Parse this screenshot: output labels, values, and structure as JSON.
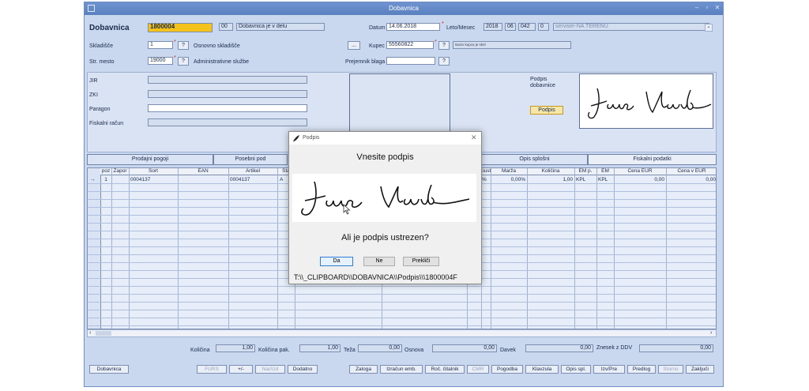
{
  "window": {
    "title": "Dobavnica"
  },
  "header": {
    "doc_label": "Dobavnica",
    "doc_number": "1800004",
    "status_code": "00",
    "status_text": "Dobavnica je v delu",
    "datum_label": "Datum",
    "datum_value": "14.06.2018",
    "leto_label": "Leto/Mesec",
    "leto_value": "2018",
    "mesec_value": "06",
    "num1": "042",
    "num2": "0",
    "servis_value": "serviser-NA TERENU",
    "skladisce_label": "Skladišče",
    "skladisce_value": "1",
    "skladisce_name": "Osnovno skladišče",
    "kupec_label": "Kupec",
    "kupec_value": "55560822",
    "kupec_name": "Naziv kupca je skrit",
    "strmesto_label": "Str. mesto",
    "strmesto_value": "19000",
    "strmesto_name": "Administrativne službe",
    "prejemnik_label": "Prejemnik blaga",
    "q": "?",
    "dots": "..."
  },
  "fiscal": {
    "jir": "JIR",
    "zki": "ZKI",
    "paragon": "Paragon",
    "racun": "Fiskalni račun"
  },
  "signature_panel": {
    "label": "Podpis dobavnice",
    "button": "Podpis"
  },
  "tabs": [
    "Prodajni pogoji",
    "Posebni pod",
    "Opis splošni",
    "Fiskalni podatki"
  ],
  "grid": {
    "headers_left": [
      "poz",
      "Zapor",
      "Sort",
      "EAN",
      "Artikel",
      "Sta"
    ],
    "headers_right": [
      "pust",
      "Marža",
      "Količina",
      "EM p.",
      "EM",
      "Cena EUR",
      "Cena v EUR"
    ],
    "row": {
      "arrow": "→",
      "poz": "1",
      "sort": "0004137",
      "artikel": "0004137",
      "sta": "A",
      "pust": "%",
      "marza": "0,00%",
      "kolicina": "1,00",
      "emp": "KPL",
      "em": "KPL",
      "cena": "0,00",
      "cenav": "0,00"
    }
  },
  "totals": {
    "kolicina_label": "Količina",
    "kolicina": "1,00",
    "kolpak_label": "Količina pak.",
    "kolpak": "1,00",
    "teza_label": "Teža",
    "teza": "0,00",
    "osnova_label": "Osnova",
    "osnova": "0,00",
    "davek_label": "Davek",
    "davek": "0,00",
    "znesek_label": "Znesek z DDV",
    "znesek": "0,00"
  },
  "bottom_buttons": {
    "dobavnica": "Dobavnica",
    "furs": "FURS",
    "plusminus": "+/-",
    "narizd": "Nar/izd",
    "dodatno": "Dodatno",
    "zaloga": "Zaloga",
    "izracun": "Izračun emb.",
    "roc": "Roč. čitalnik",
    "cmr": "CMR",
    "pogodba": "Pogodba",
    "klavzula": "Klavzula",
    "opisspl": "Opis spl.",
    "izvpre": "Izv/Pre",
    "predlog": "Predlog",
    "storno": "Storno",
    "zakljuci": "Zaključi"
  },
  "dialog": {
    "title": "Podpis",
    "prompt": "Vnesite podpis",
    "question": "Ali je podpis ustrezen?",
    "yes": "Da",
    "no": "Ne",
    "cancel": "Prekliči",
    "path": "T:\\\\_CLIPBOARD\\\\DOBAVNICA\\\\Podpis\\\\\\1800004F"
  },
  "colors": {
    "accent": "#f4c21b",
    "titlebar": "#5a80c0",
    "window": "#c9d8ef"
  }
}
